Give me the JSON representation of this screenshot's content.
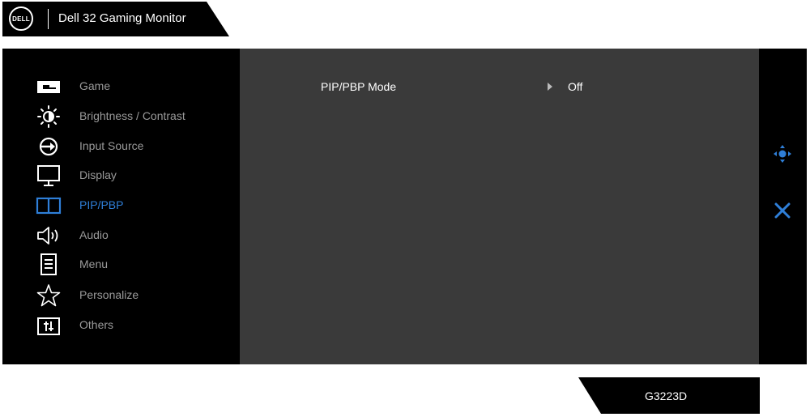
{
  "header": {
    "logo_text": "DELL",
    "title": "Dell 32 Gaming Monitor"
  },
  "sidebar": {
    "items": [
      {
        "label": "Game",
        "icon": "game-icon",
        "active": false
      },
      {
        "label": "Brightness / Contrast",
        "icon": "brightness-icon",
        "active": false
      },
      {
        "label": "Input Source",
        "icon": "input-source-icon",
        "active": false
      },
      {
        "label": "Display",
        "icon": "display-icon",
        "active": false
      },
      {
        "label": "PIP/PBP",
        "icon": "pip-pbp-icon",
        "active": true
      },
      {
        "label": "Audio",
        "icon": "speaker-icon",
        "active": false
      },
      {
        "label": "Menu",
        "icon": "menu-icon",
        "active": false
      },
      {
        "label": "Personalize",
        "icon": "star-icon",
        "active": false
      },
      {
        "label": "Others",
        "icon": "sliders-icon",
        "active": false
      }
    ]
  },
  "main": {
    "settings": [
      {
        "label": "PIP/PBP Mode",
        "value": "Off"
      }
    ]
  },
  "right_rail": {
    "navigate_icon": "navigate-dpad-icon",
    "close_icon": "close-icon"
  },
  "footer": {
    "model": "G3223D"
  },
  "colors": {
    "accent": "#2f7fd8",
    "inactive_text": "#9a9a9a",
    "panel_bg": "#3a3a3a",
    "osd_bg": "#000000"
  }
}
